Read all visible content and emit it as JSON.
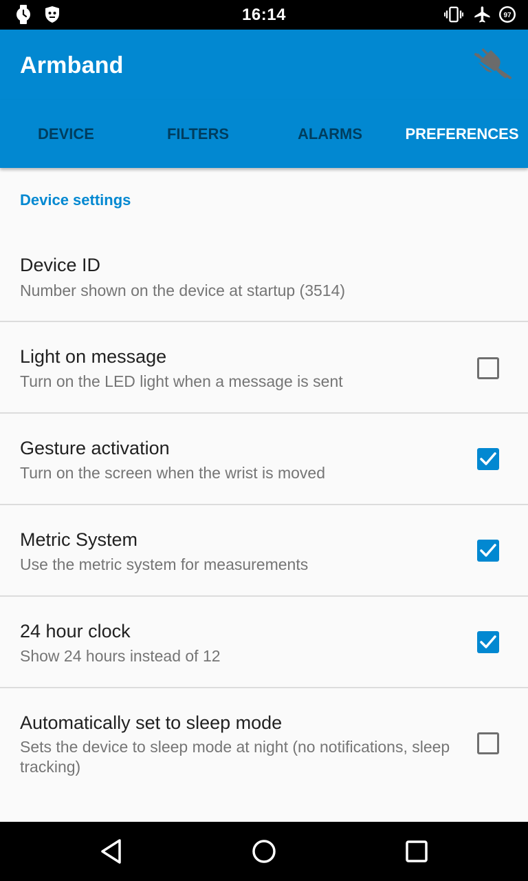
{
  "status_bar": {
    "time": "16:14",
    "battery_level": "97",
    "icons": [
      "watch-icon",
      "shield-robot-icon",
      "vibrate-icon",
      "airplane-mode-icon",
      "battery-icon"
    ]
  },
  "app_bar": {
    "title": "Armband",
    "action_icon": "disconnected-plug-icon"
  },
  "tabs": [
    {
      "label": "DEVICE",
      "active": false
    },
    {
      "label": "FILTERS",
      "active": false
    },
    {
      "label": "ALARMS",
      "active": false
    },
    {
      "label": "PREFERENCES",
      "active": true
    }
  ],
  "section": {
    "header": "Device settings"
  },
  "preferences": [
    {
      "title": "Device ID",
      "summary": "Number shown on the device at startup (3514)",
      "has_checkbox": false
    },
    {
      "title": "Light on message",
      "summary": "Turn on the LED light when a message is sent",
      "has_checkbox": true,
      "checked": false
    },
    {
      "title": "Gesture activation",
      "summary": "Turn on the screen when the wrist is moved",
      "has_checkbox": true,
      "checked": true
    },
    {
      "title": "Metric System",
      "summary": "Use the metric system for measurements",
      "has_checkbox": true,
      "checked": true
    },
    {
      "title": "24 hour clock",
      "summary": "Show 24 hours instead of 12",
      "has_checkbox": true,
      "checked": true
    },
    {
      "title": "Automatically set to sleep mode",
      "summary": "Sets the device to sleep mode at night (no notifications, sleep tracking)",
      "has_checkbox": true,
      "checked": false
    }
  ],
  "nav_bar": {
    "buttons": [
      "back-icon",
      "home-icon",
      "recents-icon"
    ]
  },
  "colors": {
    "primary": "#0288d1",
    "status_bar": "#000000",
    "background": "#fafafa"
  }
}
